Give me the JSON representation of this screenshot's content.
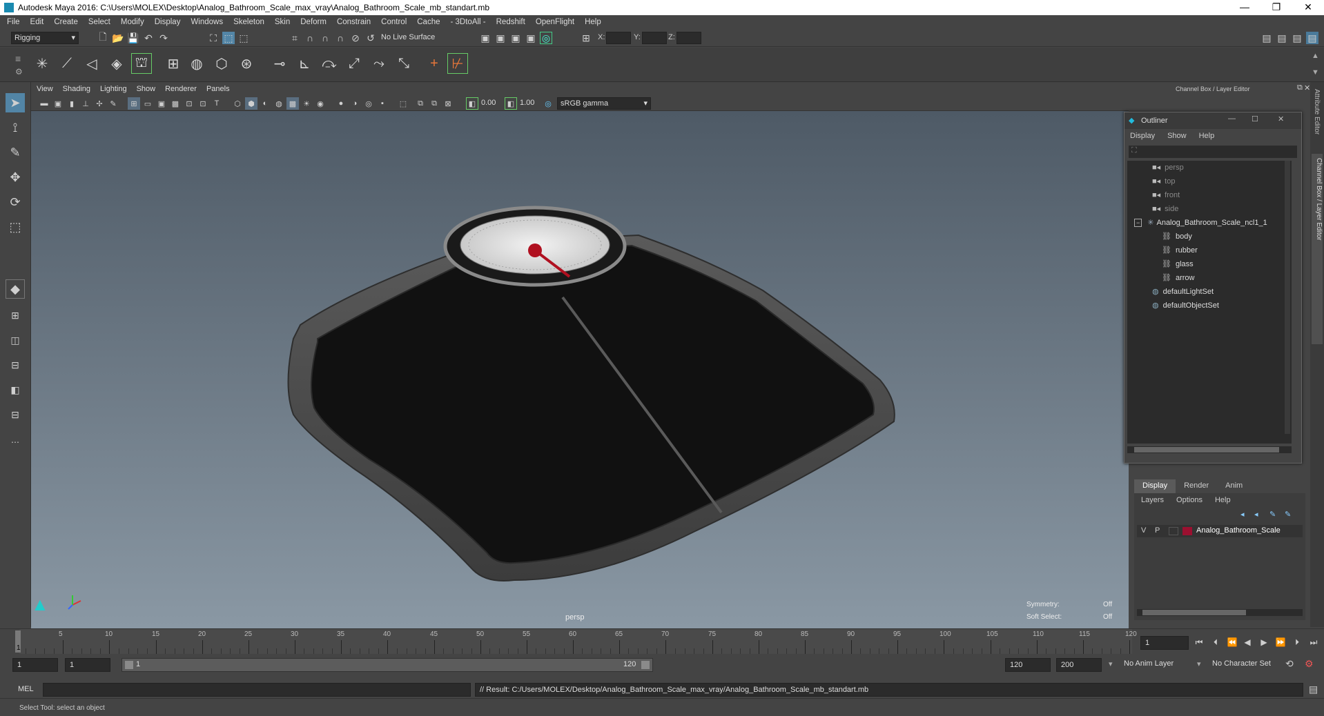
{
  "titlebar": {
    "title": "Autodesk Maya 2016: C:\\Users\\MOLEX\\Desktop\\Analog_Bathroom_Scale_max_vray\\Analog_Bathroom_Scale_mb_standart.mb",
    "minimize": "—",
    "restore": "❐",
    "close": "✕"
  },
  "menubar": [
    "File",
    "Edit",
    "Create",
    "Select",
    "Modify",
    "Display",
    "Windows",
    "Skeleton",
    "Skin",
    "Deform",
    "Constrain",
    "Control",
    "Cache",
    "- 3DtoAll -",
    "Redshift",
    "OpenFlight",
    "Help"
  ],
  "statusline": {
    "mode": "Rigging",
    "live_surface": "No Live Surface",
    "x_label": "X:",
    "y_label": "Y:",
    "z_label": "Z:"
  },
  "panel": {
    "menus": [
      "View",
      "Shading",
      "Lighting",
      "Show",
      "Renderer",
      "Panels"
    ],
    "exposure": "0.00",
    "gamma": "1.00",
    "colorspace": "sRGB gamma"
  },
  "viewport": {
    "camera": "persp",
    "symmetry_label": "Symmetry:",
    "symmetry_value": "Off",
    "soft_select_label": "Soft Select:",
    "soft_select_value": "Off"
  },
  "channelbox": {
    "title": "Channel Box / Layer Editor"
  },
  "outliner": {
    "title": "Outliner",
    "menus": [
      "Display",
      "Show",
      "Help"
    ],
    "items": [
      {
        "label": "persp",
        "dim": true
      },
      {
        "label": "top",
        "dim": true
      },
      {
        "label": "front",
        "dim": true
      },
      {
        "label": "side",
        "dim": true
      },
      {
        "label": "Analog_Bathroom_Scale_ncl1_1",
        "dim": false
      },
      {
        "label": "body",
        "dim": false
      },
      {
        "label": "rubber",
        "dim": false
      },
      {
        "label": "glass",
        "dim": false
      },
      {
        "label": "arrow",
        "dim": false
      },
      {
        "label": "defaultLightSet",
        "dim": false
      },
      {
        "label": "defaultObjectSet",
        "dim": false
      }
    ]
  },
  "layer_editor": {
    "tabs": [
      "Display",
      "Render",
      "Anim"
    ],
    "menus": [
      "Layers",
      "Options",
      "Help"
    ],
    "layer": {
      "v": "V",
      "p": "P",
      "name": "Analog_Bathroom_Scale",
      "color": "#9b1030"
    }
  },
  "vertical_tabs": [
    "Attribute Editor",
    "Channel Box / Layer Editor"
  ],
  "timeslider": {
    "ticks": [
      "5",
      "10",
      "15",
      "20",
      "25",
      "30",
      "35",
      "40",
      "45",
      "50",
      "55",
      "60",
      "65",
      "70",
      "75",
      "80",
      "85",
      "90",
      "95",
      "100",
      "105",
      "110",
      "115",
      "120"
    ],
    "current_frame_mark": "1",
    "current_frame": "1"
  },
  "rangeslider": {
    "start": "1",
    "start2": "1",
    "range_start": "1",
    "range_end": "120",
    "end": "120",
    "end2": "200",
    "anim_layer": "No Anim Layer",
    "character_set": "No Character Set"
  },
  "cmdline": {
    "label": "MEL",
    "result": "// Result: C:/Users/MOLEX/Desktop/Analog_Bathroom_Scale_max_vray/Analog_Bathroom_Scale_mb_standart.mb"
  },
  "helpline": {
    "text": "Select Tool: select an object"
  }
}
